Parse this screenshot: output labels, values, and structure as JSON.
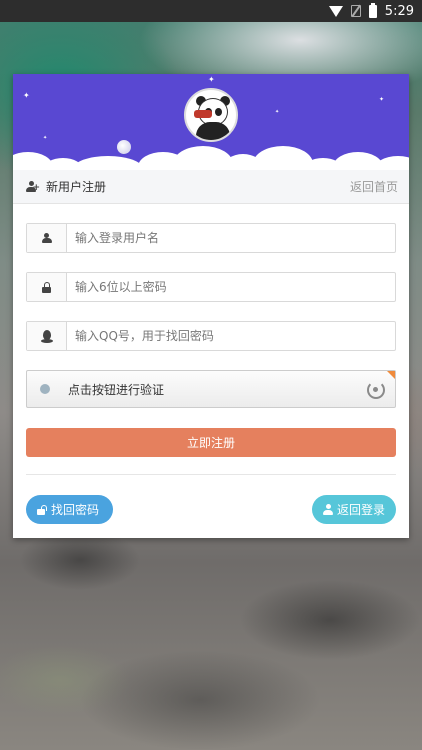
{
  "status_bar": {
    "time": "5:29",
    "icons": [
      "wifi-icon",
      "no-sim-icon",
      "battery-icon"
    ]
  },
  "colors": {
    "banner": "#5948d2",
    "register_button": "#e5805e",
    "find_password_button": "#4aa3df",
    "back_login_button": "#56c6d9"
  },
  "header": {
    "title": "新用户注册",
    "back_home": "返回首页"
  },
  "form": {
    "username_placeholder": "输入登录用户名",
    "password_placeholder": "输入6位以上密码",
    "qq_placeholder": "输入QQ号，用于找回密码",
    "verify_text": "点击按钮进行验证"
  },
  "actions": {
    "register": "立即注册",
    "find_password": "找回密码",
    "back_login": "返回登录"
  }
}
